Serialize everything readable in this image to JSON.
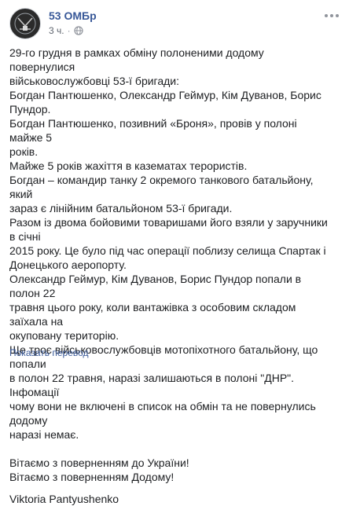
{
  "post": {
    "page_name": "53 ОМБр",
    "time": "3 ч.",
    "separator": "·",
    "lines": [
      "29-го грудня в рамках обміну полоненими додому повернулися",
      "військовослужбовці 53-ї бригади:",
      "Богдан Пантюшенко, Олександр Геймур, Кім Дуванов, Борис",
      "Пундор.",
      "Богдан Пантюшенко, позивний «Броня», провів у полоні майже 5",
      "років.",
      "Майже 5 років жахіття в казематах терористів.",
      "Богдан – командир танку 2 окремого танкового батальйону, який",
      "зараз є лінійним батальйоном 53-ї бригади.",
      "Разом із двома бойовими товаришами його взяли у заручники в січні",
      "2015 року. Це було під час операції поблизу селища Спартак і",
      "Донецького аеропорту.",
      "Олександр Геймур, Кім Дуванов, Борис Пундор попали в полон 22",
      "травня цього року, коли вантажівка з особовим складом заїхала на",
      "окуповану територію.",
      "Ще троє військовослужбовців мотопіхотного батальйону, що попали",
      "в полон 22 травня, наразі залишаються в полоні \"ДНР\". Інфомації",
      "чому вони не включені в список на обмін та не повернулись додому",
      "наразі немає."
    ],
    "greeting_flag_line": "Вітаємо з поверненням до України!",
    "greeting_home": "Вітаємо з поверненням Додому!",
    "signature": "Viktoria Pantyushenko",
    "translate_link": "Показать перевод"
  },
  "colors": {
    "link": "#385898",
    "text": "#1c1e21",
    "meta": "#616770",
    "flag_blue": "#0057b7",
    "flag_yellow": "#ffd700"
  },
  "icons": {
    "avatar": "brigade-emblem",
    "privacy": "globe-icon",
    "menu": "more-options-icon",
    "flag": "ukraine-flag-icon"
  }
}
